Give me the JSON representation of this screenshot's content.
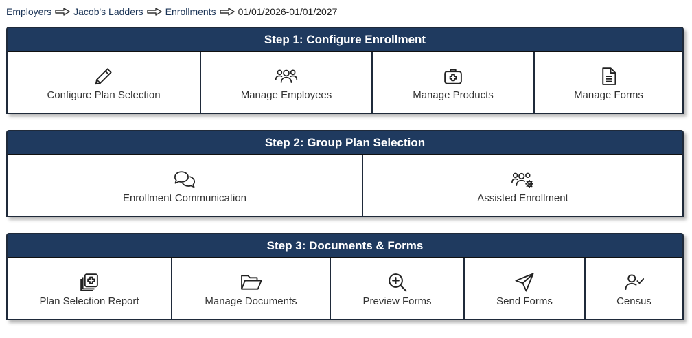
{
  "breadcrumb": {
    "items": [
      "Employers",
      "Jacob's Ladders",
      "Enrollments"
    ],
    "current": "01/01/2026-01/01/2027"
  },
  "steps": [
    {
      "title": "Step 1: Configure Enrollment",
      "tiles": [
        {
          "label": "Configure Plan Selection",
          "icon": "pencil-icon"
        },
        {
          "label": "Manage Employees",
          "icon": "users-icon"
        },
        {
          "label": "Manage Products",
          "icon": "medical-kit-icon"
        },
        {
          "label": "Manage Forms",
          "icon": "document-icon"
        }
      ]
    },
    {
      "title": "Step 2: Group Plan Selection",
      "tiles": [
        {
          "label": "Enrollment Communication",
          "icon": "chat-bubbles-icon"
        },
        {
          "label": "Assisted Enrollment",
          "icon": "users-gear-icon"
        }
      ]
    },
    {
      "title": "Step 3: Documents & Forms",
      "tiles": [
        {
          "label": "Plan Selection Report",
          "icon": "copy-plus-icon"
        },
        {
          "label": "Manage Documents",
          "icon": "folder-open-icon"
        },
        {
          "label": "Preview Forms",
          "icon": "zoom-in-icon"
        },
        {
          "label": "Send Forms",
          "icon": "paper-plane-icon"
        },
        {
          "label": "Census",
          "icon": "user-check-icon"
        }
      ]
    }
  ],
  "colors": {
    "header_bg": "#1f3a5f",
    "border": "#1f2a3a",
    "link": "#1c3557"
  }
}
